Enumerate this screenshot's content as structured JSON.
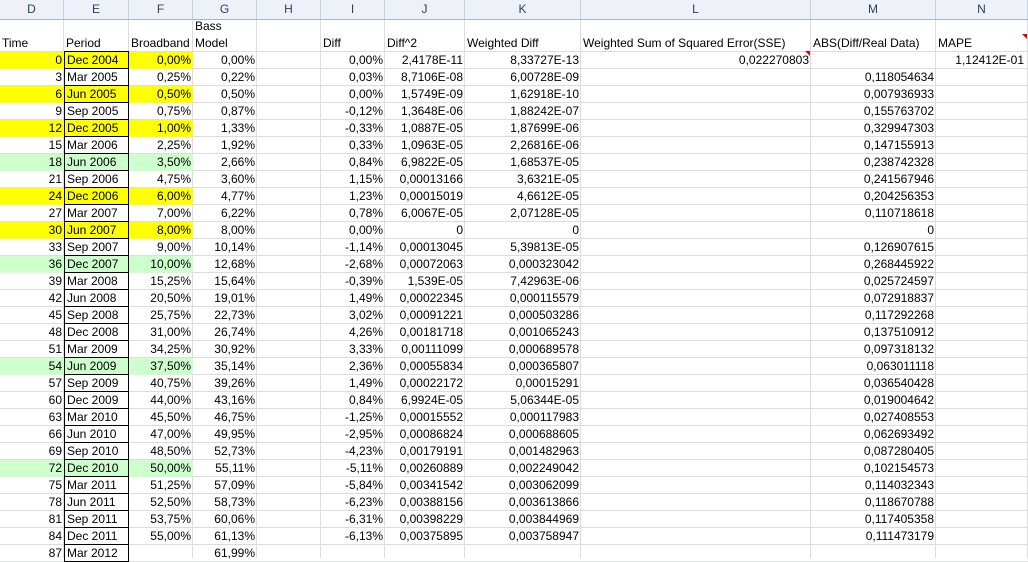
{
  "columns": [
    "D",
    "E",
    "F",
    "G",
    "H",
    "I",
    "J",
    "K",
    "L",
    "M",
    "N"
  ],
  "headers": {
    "time": "Time",
    "period": "Period",
    "broadband": "Broadband",
    "bass": "Bass",
    "model": "Model",
    "diff": "Diff",
    "diff2": "Diff^2",
    "wdiff": "Weighted Diff",
    "sse": "Weighted Sum of Squared Error(SSE)",
    "abs": "ABS(Diff/Real Data)",
    "mape": "MAPE"
  },
  "sse_value": "0,022270803",
  "mape_value": "1,12412E-01",
  "rows": [
    {
      "time": "0",
      "period": "Dec 2004",
      "broadband": "0,00%",
      "model": "0,00%",
      "diff": "0,00%",
      "diff2": "2,4178E-11",
      "wdiff": "8,33727E-13",
      "abs": "",
      "hl": "y"
    },
    {
      "time": "3",
      "period": "Mar 2005",
      "broadband": "0,25%",
      "model": "0,22%",
      "diff": "0,03%",
      "diff2": "8,7106E-08",
      "wdiff": "6,00728E-09",
      "abs": "0,118054634",
      "hl": ""
    },
    {
      "time": "6",
      "period": "Jun 2005",
      "broadband": "0,50%",
      "model": "0,50%",
      "diff": "0,00%",
      "diff2": "1,5749E-09",
      "wdiff": "1,62918E-10",
      "abs": "0,007936933",
      "hl": "y"
    },
    {
      "time": "9",
      "period": "Sep 2005",
      "broadband": "0,75%",
      "model": "0,87%",
      "diff": "-0,12%",
      "diff2": "1,3648E-06",
      "wdiff": "1,88242E-07",
      "abs": "0,155763702",
      "hl": ""
    },
    {
      "time": "12",
      "period": "Dec 2005",
      "broadband": "1,00%",
      "model": "1,33%",
      "diff": "-0,33%",
      "diff2": "1,0887E-05",
      "wdiff": "1,87699E-06",
      "abs": "0,329947303",
      "hl": "y"
    },
    {
      "time": "15",
      "period": "Mar 2006",
      "broadband": "2,25%",
      "model": "1,92%",
      "diff": "0,33%",
      "diff2": "1,0963E-05",
      "wdiff": "2,26816E-06",
      "abs": "0,147155913",
      "hl": ""
    },
    {
      "time": "18",
      "period": "Jun 2006",
      "broadband": "3,50%",
      "model": "2,66%",
      "diff": "0,84%",
      "diff2": "6,9822E-05",
      "wdiff": "1,68537E-05",
      "abs": "0,238742328",
      "hl": "g"
    },
    {
      "time": "21",
      "period": "Sep 2006",
      "broadband": "4,75%",
      "model": "3,60%",
      "diff": "1,15%",
      "diff2": "0,00013166",
      "wdiff": "3,6321E-05",
      "abs": "0,241567946",
      "hl": ""
    },
    {
      "time": "24",
      "period": "Dec 2006",
      "broadband": "6,00%",
      "model": "4,77%",
      "diff": "1,23%",
      "diff2": "0,00015019",
      "wdiff": "4,6612E-05",
      "abs": "0,204256353",
      "hl": "y"
    },
    {
      "time": "27",
      "period": "Mar 2007",
      "broadband": "7,00%",
      "model": "6,22%",
      "diff": "0,78%",
      "diff2": "6,0067E-05",
      "wdiff": "2,07128E-05",
      "abs": "0,110718618",
      "hl": ""
    },
    {
      "time": "30",
      "period": "Jun 2007",
      "broadband": "8,00%",
      "model": "8,00%",
      "diff": "0,00%",
      "diff2": "0",
      "wdiff": "0",
      "abs": "0",
      "hl": "y"
    },
    {
      "time": "33",
      "period": "Sep 2007",
      "broadband": "9,00%",
      "model": "10,14%",
      "diff": "-1,14%",
      "diff2": "0,00013045",
      "wdiff": "5,39813E-05",
      "abs": "0,126907615",
      "hl": ""
    },
    {
      "time": "36",
      "period": "Dec 2007",
      "broadband": "10,00%",
      "model": "12,68%",
      "diff": "-2,68%",
      "diff2": "0,00072063",
      "wdiff": "0,000323042",
      "abs": "0,268445922",
      "hl": "g"
    },
    {
      "time": "39",
      "period": "Mar 2008",
      "broadband": "15,25%",
      "model": "15,64%",
      "diff": "-0,39%",
      "diff2": "1,539E-05",
      "wdiff": "7,42963E-06",
      "abs": "0,025724597",
      "hl": ""
    },
    {
      "time": "42",
      "period": "Jun 2008",
      "broadband": "20,50%",
      "model": "19,01%",
      "diff": "1,49%",
      "diff2": "0,00022345",
      "wdiff": "0,000115579",
      "abs": "0,072918837",
      "hl": ""
    },
    {
      "time": "45",
      "period": "Sep 2008",
      "broadband": "25,75%",
      "model": "22,73%",
      "diff": "3,02%",
      "diff2": "0,00091221",
      "wdiff": "0,000503286",
      "abs": "0,117292268",
      "hl": ""
    },
    {
      "time": "48",
      "period": "Dec 2008",
      "broadband": "31,00%",
      "model": "26,74%",
      "diff": "4,26%",
      "diff2": "0,00181718",
      "wdiff": "0,001065243",
      "abs": "0,137510912",
      "hl": ""
    },
    {
      "time": "51",
      "period": "Mar 2009",
      "broadband": "34,25%",
      "model": "30,92%",
      "diff": "3,33%",
      "diff2": "0,00111099",
      "wdiff": "0,000689578",
      "abs": "0,097318132",
      "hl": ""
    },
    {
      "time": "54",
      "period": "Jun 2009",
      "broadband": "37,50%",
      "model": "35,14%",
      "diff": "2,36%",
      "diff2": "0,00055834",
      "wdiff": "0,000365807",
      "abs": "0,063011118",
      "hl": "g"
    },
    {
      "time": "57",
      "period": "Sep 2009",
      "broadband": "40,75%",
      "model": "39,26%",
      "diff": "1,49%",
      "diff2": "0,00022172",
      "wdiff": "0,00015291",
      "abs": "0,036540428",
      "hl": ""
    },
    {
      "time": "60",
      "period": "Dec 2009",
      "broadband": "44,00%",
      "model": "43,16%",
      "diff": "0,84%",
      "diff2": "6,9924E-05",
      "wdiff": "5,06344E-05",
      "abs": "0,019004642",
      "hl": ""
    },
    {
      "time": "63",
      "period": "Mar 2010",
      "broadband": "45,50%",
      "model": "46,75%",
      "diff": "-1,25%",
      "diff2": "0,00015552",
      "wdiff": "0,000117983",
      "abs": "0,027408553",
      "hl": ""
    },
    {
      "time": "66",
      "period": "Jun 2010",
      "broadband": "47,00%",
      "model": "49,95%",
      "diff": "-2,95%",
      "diff2": "0,00086824",
      "wdiff": "0,000688605",
      "abs": "0,062693492",
      "hl": ""
    },
    {
      "time": "69",
      "period": "Sep 2010",
      "broadband": "48,50%",
      "model": "52,73%",
      "diff": "-4,23%",
      "diff2": "0,00179191",
      "wdiff": "0,001482963",
      "abs": "0,087280405",
      "hl": ""
    },
    {
      "time": "72",
      "period": "Dec 2010",
      "broadband": "50,00%",
      "model": "55,11%",
      "diff": "-5,11%",
      "diff2": "0,00260889",
      "wdiff": "0,002249042",
      "abs": "0,102154573",
      "hl": "g"
    },
    {
      "time": "75",
      "period": "Mar 2011",
      "broadband": "51,25%",
      "model": "57,09%",
      "diff": "-5,84%",
      "diff2": "0,00341542",
      "wdiff": "0,003062099",
      "abs": "0,114032343",
      "hl": ""
    },
    {
      "time": "78",
      "period": "Jun 2011",
      "broadband": "52,50%",
      "model": "58,73%",
      "diff": "-6,23%",
      "diff2": "0,00388156",
      "wdiff": "0,003613866",
      "abs": "0,118670788",
      "hl": ""
    },
    {
      "time": "81",
      "period": "Sep 2011",
      "broadband": "53,75%",
      "model": "60,06%",
      "diff": "-6,31%",
      "diff2": "0,00398229",
      "wdiff": "0,003844969",
      "abs": "0,117405358",
      "hl": ""
    },
    {
      "time": "84",
      "period": "Dec 2011",
      "broadband": "55,00%",
      "model": "61,13%",
      "diff": "-6,13%",
      "diff2": "0,00375895",
      "wdiff": "0,003758947",
      "abs": "0,111473179",
      "hl": ""
    },
    {
      "time": "87",
      "period": "Mar 2012",
      "broadband": "",
      "model": "61,99%",
      "diff": "",
      "diff2": "",
      "wdiff": "",
      "abs": "",
      "hl": ""
    }
  ],
  "colors": {
    "highlight_yellow": "#ffff00",
    "highlight_green": "#ccffcc",
    "comment_marker": "#e00000"
  }
}
